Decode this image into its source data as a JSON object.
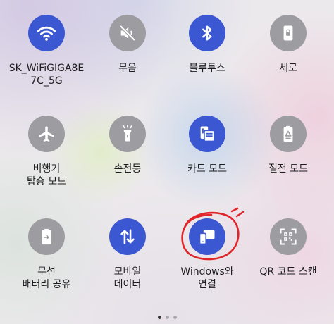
{
  "tiles": [
    {
      "label": "SK_WiFiGIGA8E\n7C_5G",
      "icon": "wifi-icon",
      "state": "on"
    },
    {
      "label": "무음",
      "icon": "mute-icon",
      "state": "off"
    },
    {
      "label": "블루투스",
      "icon": "bluetooth-icon",
      "state": "on"
    },
    {
      "label": "세로",
      "icon": "portrait-lock-icon",
      "state": "off"
    },
    {
      "label": "비행기\n탑승 모드",
      "icon": "airplane-icon",
      "state": "off"
    },
    {
      "label": "손전등",
      "icon": "flashlight-icon",
      "state": "off"
    },
    {
      "label": "카드 모드",
      "icon": "card-mode-icon",
      "state": "on"
    },
    {
      "label": "절전 모드",
      "icon": "power-saving-icon",
      "state": "off"
    },
    {
      "label": "무선\n배터리 공유",
      "icon": "wireless-battery-share-icon",
      "state": "off"
    },
    {
      "label": "모바일\n데이터",
      "icon": "mobile-data-icon",
      "state": "on"
    },
    {
      "label": "Windows와\n연결",
      "icon": "link-to-windows-icon",
      "state": "on"
    },
    {
      "label": "QR 코드 스캔",
      "icon": "qr-scan-icon",
      "state": "off"
    }
  ],
  "colors": {
    "on": "#3b57d1",
    "off": "#9c9ca1",
    "annotation": "#e0262b"
  },
  "pager": {
    "pages": 3,
    "current": 1
  }
}
